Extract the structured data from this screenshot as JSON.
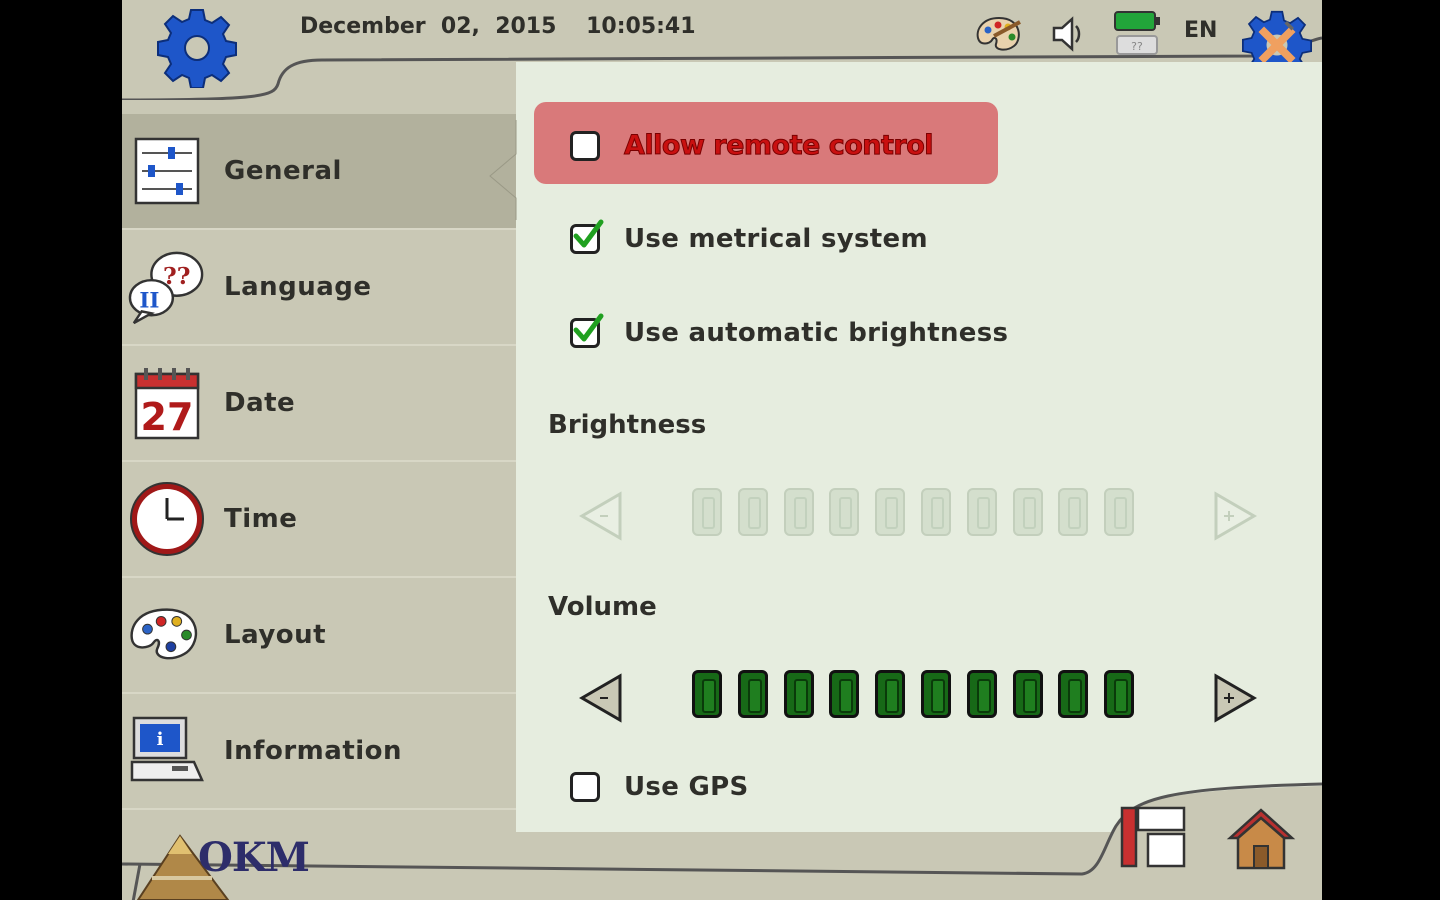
{
  "header": {
    "date": "December  02,  2015",
    "time": "10:05:41",
    "language_code": "EN",
    "icons": [
      "settings-gear-icon",
      "palette-icon",
      "speaker-icon",
      "battery-icon",
      "settings-tools-icon"
    ]
  },
  "sidebar": {
    "items": [
      {
        "label": "General",
        "icon": "sliders-icon",
        "active": true
      },
      {
        "label": "Language",
        "icon": "speech-bubbles-icon",
        "icon_text": "??"
      },
      {
        "label": "Date",
        "icon": "calendar-icon",
        "icon_text": "27"
      },
      {
        "label": "Time",
        "icon": "clock-icon"
      },
      {
        "label": "Layout",
        "icon": "palette-icon"
      },
      {
        "label": "Information",
        "icon": "computer-info-icon",
        "icon_text": "i"
      }
    ]
  },
  "settings": {
    "allow_remote_control": {
      "label": "Allow remote control",
      "checked": false,
      "highlight_color": "#d9797a"
    },
    "metric": {
      "label": "Use metrical system",
      "checked": true
    },
    "auto_brightness": {
      "label": "Use automatic brightness",
      "checked": true
    },
    "brightness": {
      "label": "Brightness",
      "level": 10,
      "max": 10,
      "enabled": false
    },
    "volume": {
      "label": "Volume",
      "level": 10,
      "max": 10,
      "enabled": true
    },
    "gps": {
      "label": "Use GPS",
      "checked": false
    }
  },
  "footer": {
    "logo_text": "OKM",
    "buttons": [
      "panel-toggle-icon",
      "home-icon"
    ]
  },
  "colors": {
    "background": "#c9c8b5",
    "panel": "#e6eddf",
    "accent_green": "#176917"
  }
}
